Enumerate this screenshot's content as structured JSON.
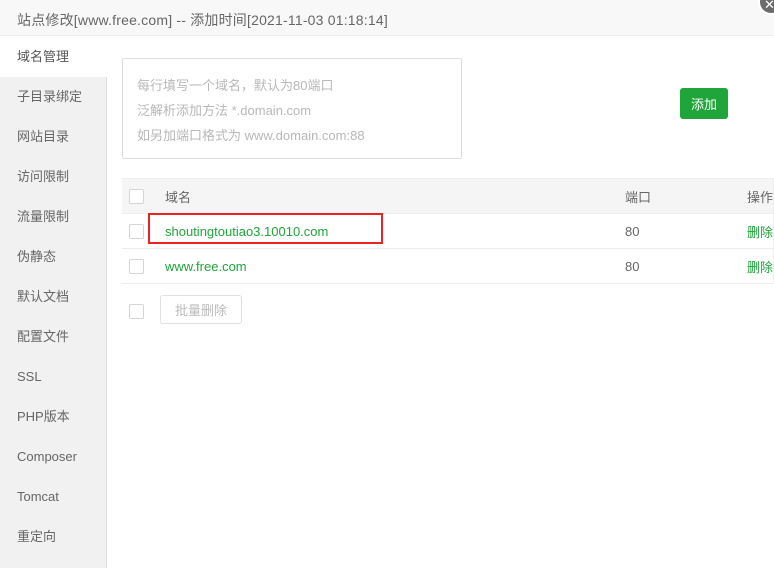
{
  "window": {
    "title": "站点修改[www.free.com] -- 添加时间[2021-11-03 01:18:14]",
    "close_label": "✕"
  },
  "sidebar": {
    "items": [
      {
        "label": "域名管理",
        "active": true
      },
      {
        "label": "子目录绑定",
        "active": false
      },
      {
        "label": "网站目录",
        "active": false
      },
      {
        "label": "访问限制",
        "active": false
      },
      {
        "label": "流量限制",
        "active": false
      },
      {
        "label": "伪静态",
        "active": false
      },
      {
        "label": "默认文档",
        "active": false
      },
      {
        "label": "配置文件",
        "active": false
      },
      {
        "label": "SSL",
        "active": false
      },
      {
        "label": "PHP版本",
        "active": false
      },
      {
        "label": "Composer",
        "active": false
      },
      {
        "label": "Tomcat",
        "active": false
      },
      {
        "label": "重定向",
        "active": false
      }
    ]
  },
  "form": {
    "textarea_value": "",
    "textarea_placeholder": "每行填写一个域名，默认为80端口\n泛解析添加方法 *.domain.com\n如另加端口格式为 www.domain.com:88",
    "add_button_label": "添加"
  },
  "table": {
    "headers": {
      "domain": "域名",
      "port": "端口",
      "action": "操作"
    },
    "rows": [
      {
        "domain": "shoutingtoutiao3.10010.com",
        "port": "80",
        "action": "删除",
        "highlighted": true
      },
      {
        "domain": "www.free.com",
        "port": "80",
        "action": "删除",
        "highlighted": false
      }
    ]
  },
  "footer": {
    "bulk_delete_label": "批量删除"
  },
  "colors": {
    "accent_green": "#20a53a",
    "annotation_red": "#ee2222",
    "sidebar_bg": "#f1f1f1",
    "header_bg": "#f8f8f8"
  }
}
